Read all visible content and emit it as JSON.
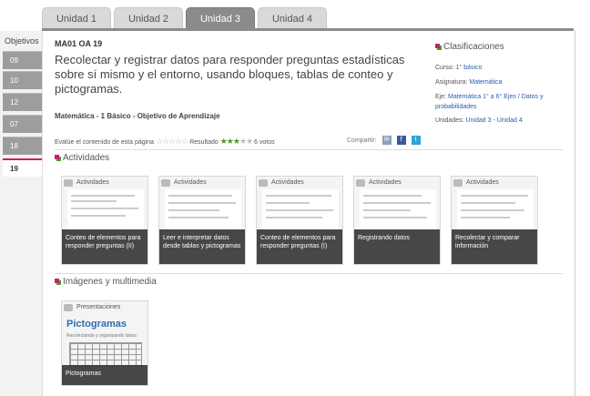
{
  "tabs": [
    "Unidad 1",
    "Unidad 2",
    "Unidad 3",
    "Unidad 4"
  ],
  "active_tab": "Unidad 3",
  "sidebar": {
    "label": "Objetivos",
    "items": [
      "09",
      "10",
      "12",
      "07",
      "18",
      "19"
    ],
    "selected": "19"
  },
  "header": {
    "code": "MA01 OA 19",
    "title": "Recolectar y registrar datos para responder preguntas estadísticas sobre sí mismo y el entorno, usando bloques, tablas de conteo y pictogramas.",
    "subtitle": "Matemática - 1 Básico - Objetivo de Aprendizaje"
  },
  "rating": {
    "evaluate_label": "Evalúe el contenido de esta página",
    "result_label": "Resultado",
    "result_stars": 3,
    "max_stars": 5,
    "votes": "6 votos",
    "share_label": "Compartir:"
  },
  "clasificaciones": {
    "title": "Clasificaciones",
    "curso_label": "Curso:",
    "curso_value": "1° básico",
    "asignatura_label": "Asignatura:",
    "asignatura_value": "Matemática",
    "eje_label": "Eje:",
    "eje_values": [
      "Matemática 1° a 6° Ejes",
      "Datos y probabilidades"
    ],
    "unidades_label": "Unidades:",
    "unidades_values": [
      "Unidad 3",
      "Unidad 4"
    ]
  },
  "actividades": {
    "title": "Actividades",
    "card_header": "Actividades",
    "cards": [
      "Conteo de elementos para responder preguntas (II)",
      "Leer e interpretar datos desde tablas y pictogramas",
      "Conteo de elementos para responder preguntas (I)",
      "Registrando datos",
      "Recolectar y comparar información"
    ]
  },
  "multimedia": {
    "title": "Imágenes y multimedia",
    "card_header": "Presentaciones",
    "card_title": "Pictogramas",
    "card_subtitle": "Recolectando y organizando datos",
    "card_caption": "Pictogramas"
  },
  "colors": {
    "accent_magenta": "#c8206c",
    "accent_green": "#4c9a2a",
    "link_blue": "#2a5db0"
  }
}
